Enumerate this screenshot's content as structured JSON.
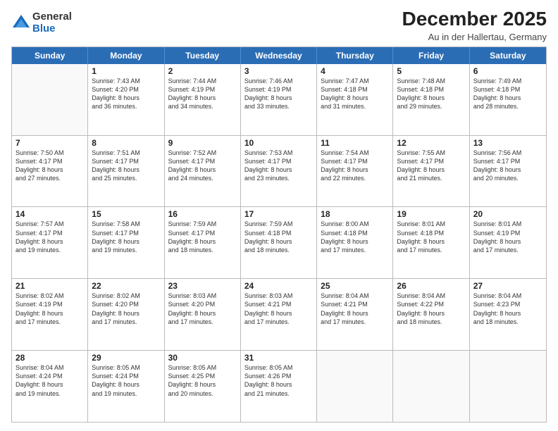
{
  "logo": {
    "general": "General",
    "blue": "Blue"
  },
  "title": "December 2025",
  "subtitle": "Au in der Hallertau, Germany",
  "header_days": [
    "Sunday",
    "Monday",
    "Tuesday",
    "Wednesday",
    "Thursday",
    "Friday",
    "Saturday"
  ],
  "weeks": [
    [
      {
        "day": "",
        "sunrise": "",
        "sunset": "",
        "daylight": "",
        "empty": true
      },
      {
        "day": "1",
        "sunrise": "Sunrise: 7:43 AM",
        "sunset": "Sunset: 4:20 PM",
        "daylight": "Daylight: 8 hours",
        "daylight2": "and 36 minutes."
      },
      {
        "day": "2",
        "sunrise": "Sunrise: 7:44 AM",
        "sunset": "Sunset: 4:19 PM",
        "daylight": "Daylight: 8 hours",
        "daylight2": "and 34 minutes."
      },
      {
        "day": "3",
        "sunrise": "Sunrise: 7:46 AM",
        "sunset": "Sunset: 4:19 PM",
        "daylight": "Daylight: 8 hours",
        "daylight2": "and 33 minutes."
      },
      {
        "day": "4",
        "sunrise": "Sunrise: 7:47 AM",
        "sunset": "Sunset: 4:18 PM",
        "daylight": "Daylight: 8 hours",
        "daylight2": "and 31 minutes."
      },
      {
        "day": "5",
        "sunrise": "Sunrise: 7:48 AM",
        "sunset": "Sunset: 4:18 PM",
        "daylight": "Daylight: 8 hours",
        "daylight2": "and 29 minutes."
      },
      {
        "day": "6",
        "sunrise": "Sunrise: 7:49 AM",
        "sunset": "Sunset: 4:18 PM",
        "daylight": "Daylight: 8 hours",
        "daylight2": "and 28 minutes."
      }
    ],
    [
      {
        "day": "7",
        "sunrise": "Sunrise: 7:50 AM",
        "sunset": "Sunset: 4:17 PM",
        "daylight": "Daylight: 8 hours",
        "daylight2": "and 27 minutes."
      },
      {
        "day": "8",
        "sunrise": "Sunrise: 7:51 AM",
        "sunset": "Sunset: 4:17 PM",
        "daylight": "Daylight: 8 hours",
        "daylight2": "and 25 minutes."
      },
      {
        "day": "9",
        "sunrise": "Sunrise: 7:52 AM",
        "sunset": "Sunset: 4:17 PM",
        "daylight": "Daylight: 8 hours",
        "daylight2": "and 24 minutes."
      },
      {
        "day": "10",
        "sunrise": "Sunrise: 7:53 AM",
        "sunset": "Sunset: 4:17 PM",
        "daylight": "Daylight: 8 hours",
        "daylight2": "and 23 minutes."
      },
      {
        "day": "11",
        "sunrise": "Sunrise: 7:54 AM",
        "sunset": "Sunset: 4:17 PM",
        "daylight": "Daylight: 8 hours",
        "daylight2": "and 22 minutes."
      },
      {
        "day": "12",
        "sunrise": "Sunrise: 7:55 AM",
        "sunset": "Sunset: 4:17 PM",
        "daylight": "Daylight: 8 hours",
        "daylight2": "and 21 minutes."
      },
      {
        "day": "13",
        "sunrise": "Sunrise: 7:56 AM",
        "sunset": "Sunset: 4:17 PM",
        "daylight": "Daylight: 8 hours",
        "daylight2": "and 20 minutes."
      }
    ],
    [
      {
        "day": "14",
        "sunrise": "Sunrise: 7:57 AM",
        "sunset": "Sunset: 4:17 PM",
        "daylight": "Daylight: 8 hours",
        "daylight2": "and 19 minutes."
      },
      {
        "day": "15",
        "sunrise": "Sunrise: 7:58 AM",
        "sunset": "Sunset: 4:17 PM",
        "daylight": "Daylight: 8 hours",
        "daylight2": "and 19 minutes."
      },
      {
        "day": "16",
        "sunrise": "Sunrise: 7:59 AM",
        "sunset": "Sunset: 4:17 PM",
        "daylight": "Daylight: 8 hours",
        "daylight2": "and 18 minutes."
      },
      {
        "day": "17",
        "sunrise": "Sunrise: 7:59 AM",
        "sunset": "Sunset: 4:18 PM",
        "daylight": "Daylight: 8 hours",
        "daylight2": "and 18 minutes."
      },
      {
        "day": "18",
        "sunrise": "Sunrise: 8:00 AM",
        "sunset": "Sunset: 4:18 PM",
        "daylight": "Daylight: 8 hours",
        "daylight2": "and 17 minutes."
      },
      {
        "day": "19",
        "sunrise": "Sunrise: 8:01 AM",
        "sunset": "Sunset: 4:18 PM",
        "daylight": "Daylight: 8 hours",
        "daylight2": "and 17 minutes."
      },
      {
        "day": "20",
        "sunrise": "Sunrise: 8:01 AM",
        "sunset": "Sunset: 4:19 PM",
        "daylight": "Daylight: 8 hours",
        "daylight2": "and 17 minutes."
      }
    ],
    [
      {
        "day": "21",
        "sunrise": "Sunrise: 8:02 AM",
        "sunset": "Sunset: 4:19 PM",
        "daylight": "Daylight: 8 hours",
        "daylight2": "and 17 minutes."
      },
      {
        "day": "22",
        "sunrise": "Sunrise: 8:02 AM",
        "sunset": "Sunset: 4:20 PM",
        "daylight": "Daylight: 8 hours",
        "daylight2": "and 17 minutes."
      },
      {
        "day": "23",
        "sunrise": "Sunrise: 8:03 AM",
        "sunset": "Sunset: 4:20 PM",
        "daylight": "Daylight: 8 hours",
        "daylight2": "and 17 minutes."
      },
      {
        "day": "24",
        "sunrise": "Sunrise: 8:03 AM",
        "sunset": "Sunset: 4:21 PM",
        "daylight": "Daylight: 8 hours",
        "daylight2": "and 17 minutes."
      },
      {
        "day": "25",
        "sunrise": "Sunrise: 8:04 AM",
        "sunset": "Sunset: 4:21 PM",
        "daylight": "Daylight: 8 hours",
        "daylight2": "and 17 minutes."
      },
      {
        "day": "26",
        "sunrise": "Sunrise: 8:04 AM",
        "sunset": "Sunset: 4:22 PM",
        "daylight": "Daylight: 8 hours",
        "daylight2": "and 18 minutes."
      },
      {
        "day": "27",
        "sunrise": "Sunrise: 8:04 AM",
        "sunset": "Sunset: 4:23 PM",
        "daylight": "Daylight: 8 hours",
        "daylight2": "and 18 minutes."
      }
    ],
    [
      {
        "day": "28",
        "sunrise": "Sunrise: 8:04 AM",
        "sunset": "Sunset: 4:24 PM",
        "daylight": "Daylight: 8 hours",
        "daylight2": "and 19 minutes."
      },
      {
        "day": "29",
        "sunrise": "Sunrise: 8:05 AM",
        "sunset": "Sunset: 4:24 PM",
        "daylight": "Daylight: 8 hours",
        "daylight2": "and 19 minutes."
      },
      {
        "day": "30",
        "sunrise": "Sunrise: 8:05 AM",
        "sunset": "Sunset: 4:25 PM",
        "daylight": "Daylight: 8 hours",
        "daylight2": "and 20 minutes."
      },
      {
        "day": "31",
        "sunrise": "Sunrise: 8:05 AM",
        "sunset": "Sunset: 4:26 PM",
        "daylight": "Daylight: 8 hours",
        "daylight2": "and 21 minutes."
      },
      {
        "day": "",
        "sunrise": "",
        "sunset": "",
        "daylight": "",
        "daylight2": "",
        "empty": true
      },
      {
        "day": "",
        "sunrise": "",
        "sunset": "",
        "daylight": "",
        "daylight2": "",
        "empty": true
      },
      {
        "day": "",
        "sunrise": "",
        "sunset": "",
        "daylight": "",
        "daylight2": "",
        "empty": true
      }
    ]
  ]
}
